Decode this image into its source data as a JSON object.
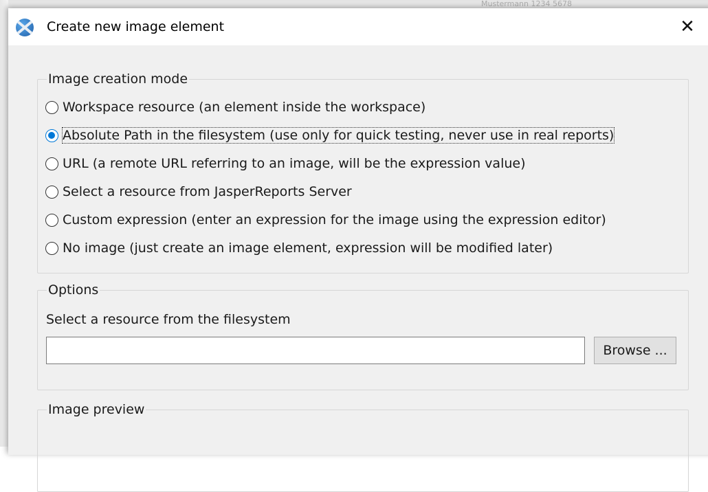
{
  "background": {
    "snippet": "Mustermann 1234 5678"
  },
  "window": {
    "title": "Create new image element",
    "close_icon": "close-icon"
  },
  "mode_group": {
    "legend": "Image creation mode",
    "options": [
      {
        "label": "Workspace resource (an element inside the workspace)",
        "checked": false
      },
      {
        "label": "Absolute Path in the filesystem (use only for quick testing, never use in real reports)",
        "checked": true
      },
      {
        "label": "URL (a remote URL referring to an image, will be the expression value)",
        "checked": false
      },
      {
        "label": "Select a resource from JasperReports Server",
        "checked": false
      },
      {
        "label": "Custom expression (enter an expression for the image using the expression editor)",
        "checked": false
      },
      {
        "label": "No image (just create an image element, expression will be modified later)",
        "checked": false
      }
    ]
  },
  "options_group": {
    "legend": "Options",
    "field_label": "Select a resource from the filesystem",
    "path_value": "",
    "browse_label": "Browse ..."
  },
  "preview_group": {
    "legend": "Image preview"
  },
  "colors": {
    "accent": "#0078d7",
    "dialog_bg": "#f0f0f0",
    "titlebar_bg": "#ffffff"
  }
}
